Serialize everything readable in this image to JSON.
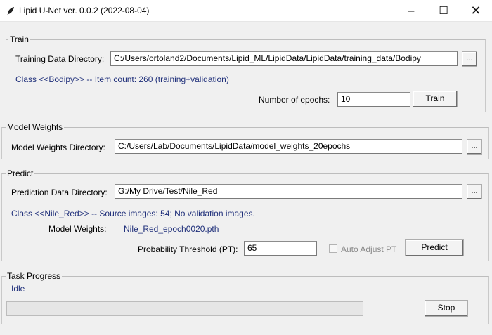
{
  "window": {
    "title": "Lipid U-Net ver. 0.0.2 (2022-08-04)",
    "minimize": "–",
    "maximize": "☐",
    "close": "✕",
    "icon": "feather-icon"
  },
  "train": {
    "frame_title": "Train",
    "dir_label": "Training Data Directory:",
    "dir_value": "C:/Users/ortoland2/Documents/Lipid_ML/LipidData/LipidData/training_data/Bodipy",
    "browse_label": "...",
    "class_info": "Class <<Bodipy>> -- Item count: 260 (training+validation)",
    "epochs_label": "Number of epochs:",
    "epochs_value": "10",
    "train_button": "Train"
  },
  "model_weights": {
    "frame_title": "Model Weights",
    "dir_label": "Model Weights Directory:",
    "dir_value": "C:/Users/Lab/Documents/LipidData/model_weights_20epochs",
    "browse_label": "..."
  },
  "predict": {
    "frame_title": "Predict",
    "dir_label": "Prediction Data Directory:",
    "dir_value": "G:/My Drive/Test/Nile_Red",
    "browse_label": "...",
    "class_info": "Class <<Nile_Red>> -- Source images: 54; No validation images.",
    "weights_label": "Model Weights:",
    "weights_value": "Nile_Red_epoch0020.pth",
    "threshold_label": "Probability Threshold (PT):",
    "threshold_value": "65",
    "auto_adjust_label": "Auto Adjust PT",
    "auto_adjust_checked": false,
    "predict_button": "Predict"
  },
  "task_progress": {
    "frame_title": "Task Progress",
    "status": "Idle",
    "progress": 0,
    "stop_button": "Stop"
  }
}
